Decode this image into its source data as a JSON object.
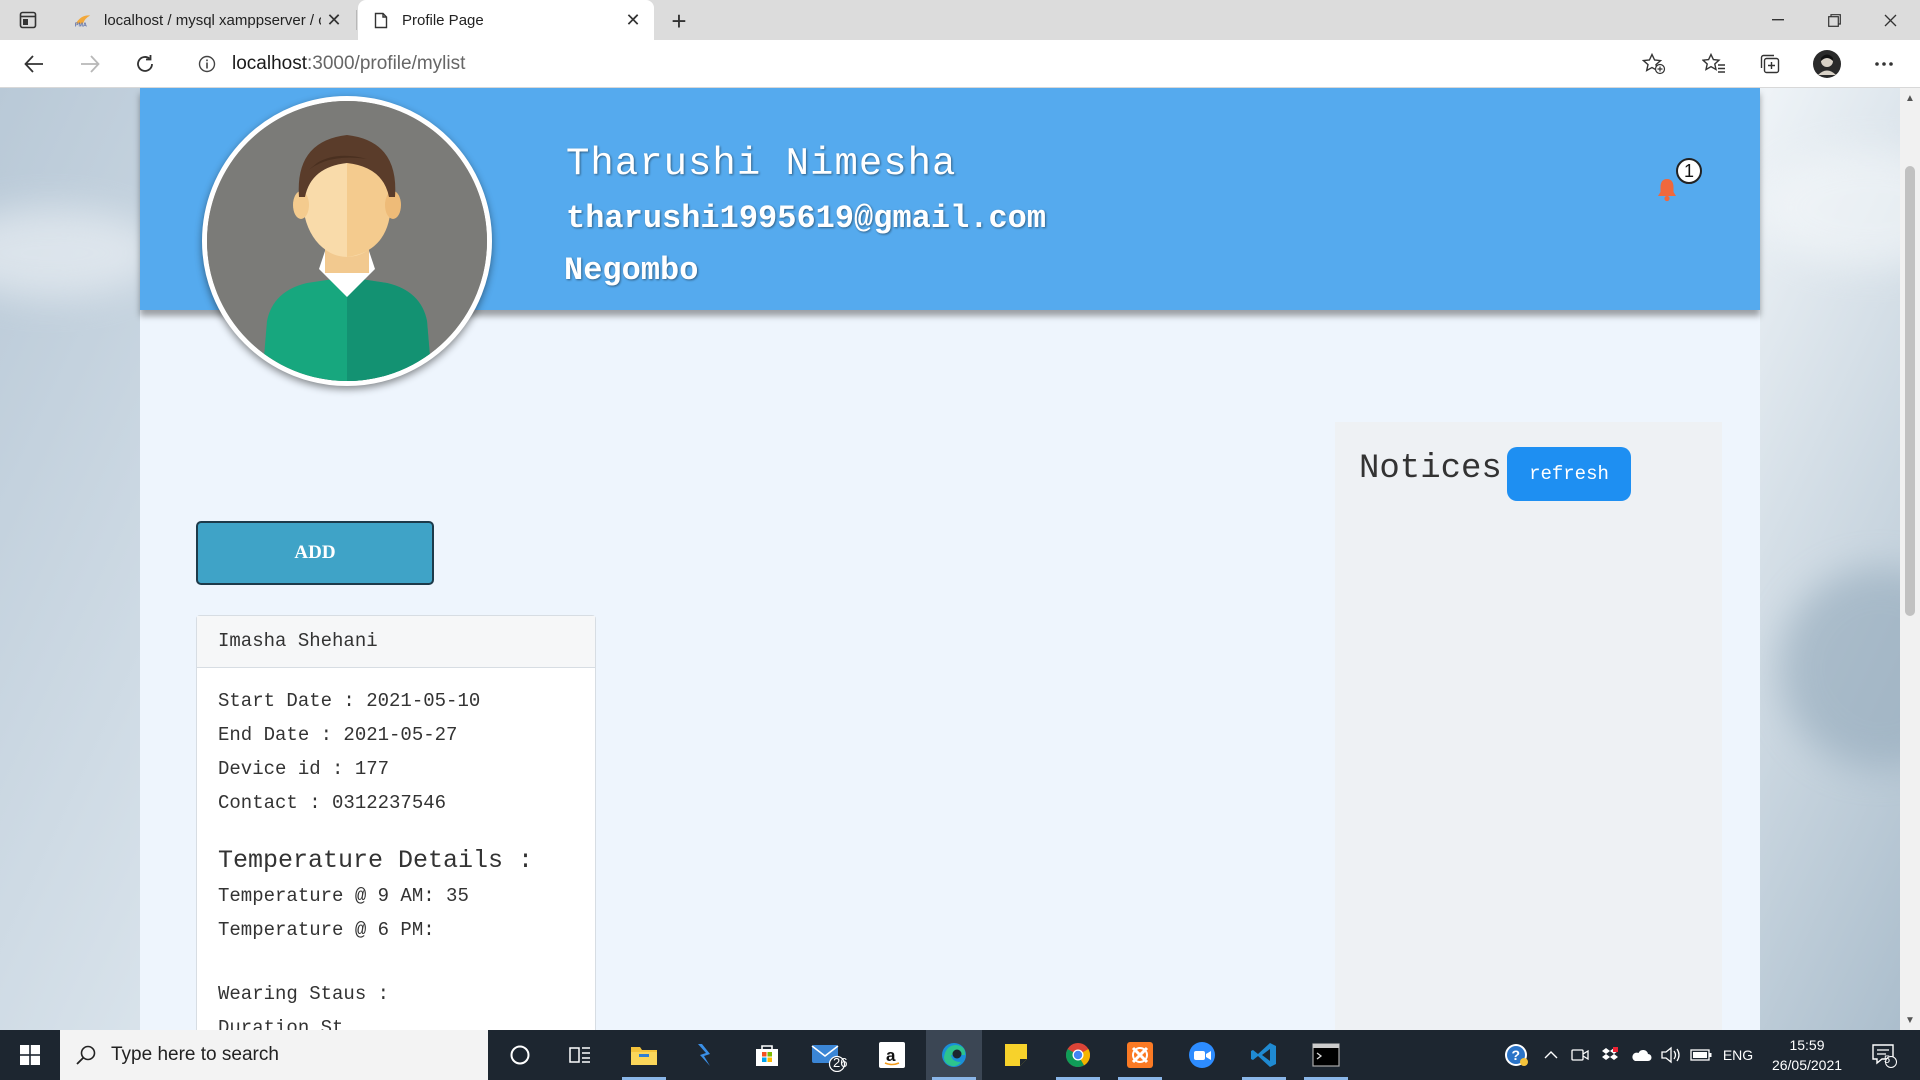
{
  "browser": {
    "tabs": [
      {
        "title": "localhost / mysql xamppserver / c",
        "favicon": "phpmyadmin-icon"
      },
      {
        "title": "Profile Page",
        "favicon": "page-icon"
      }
    ],
    "address": {
      "host": "localhost",
      "path": ":3000/profile/mylist"
    }
  },
  "profile": {
    "name": "Tharushi Nimesha",
    "email": "tharushi1995619@gmail.com",
    "city": "Negombo",
    "notification_count": "1"
  },
  "actions": {
    "add_label": "ADD"
  },
  "card": {
    "title": "Imasha Shehani",
    "start_date": "Start Date : 2021-05-10",
    "end_date": "End Date : 2021-05-27",
    "device_id": "Device id : 177",
    "contact": "Contact : 0312237546",
    "temp_heading": "Temperature Details :",
    "temp_9am": "Temperature @ 9 AM: 35",
    "temp_6pm": "Temperature @ 6 PM:",
    "wearing_heading": "Wearing Staus :",
    "wearing_next": "Duration St..."
  },
  "notices": {
    "title": "Notices",
    "refresh_label": "refresh"
  },
  "taskbar": {
    "search_placeholder": "Type here to search",
    "mail_badge": "26",
    "language": "ENG",
    "time": "15:59",
    "date": "26/05/2021",
    "notification_count": "5"
  },
  "colors": {
    "header_blue": "#55aaee",
    "refresh_blue": "#1e8ff2",
    "add_teal": "#3fa3c7"
  }
}
